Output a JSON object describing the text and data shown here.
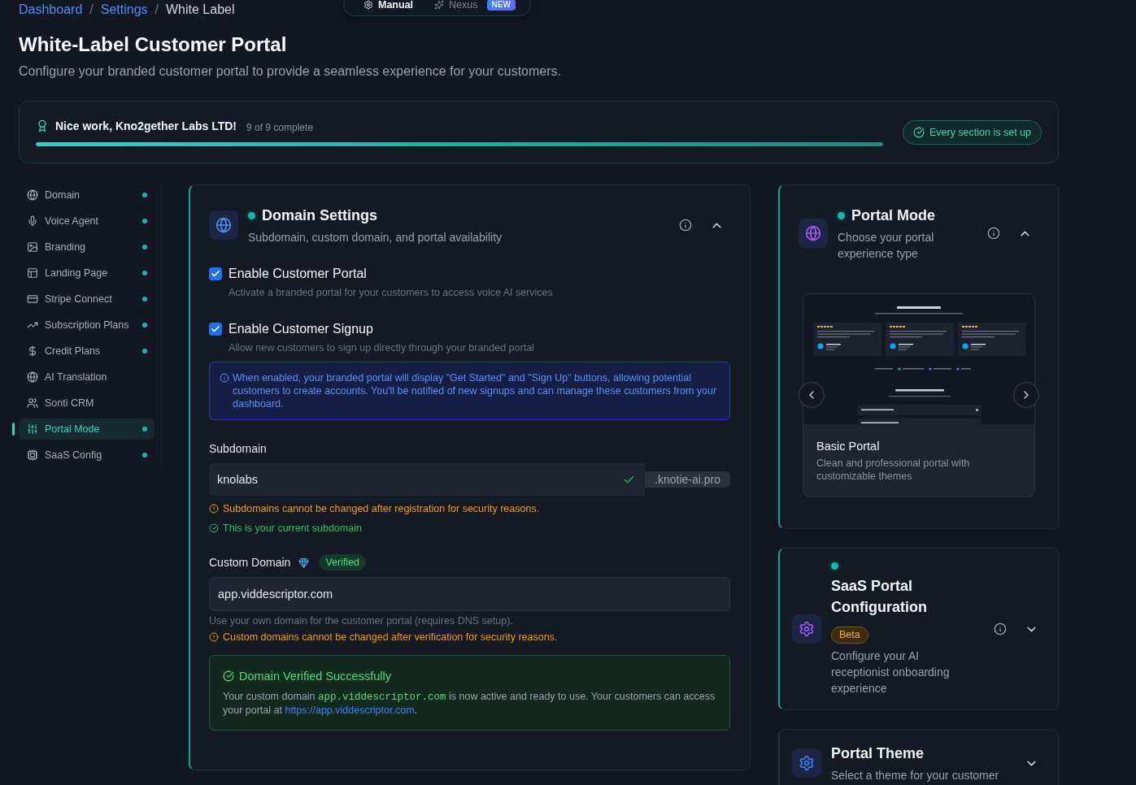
{
  "breadcrumb": {
    "items": [
      {
        "label": "Dashboard",
        "current": false
      },
      {
        "label": "Settings",
        "current": false
      },
      {
        "label": "White Label",
        "current": true
      }
    ],
    "separators": [
      "/",
      "/"
    ]
  },
  "mode_switch": {
    "options": [
      {
        "label": "Manual",
        "selected": true
      },
      {
        "label": "Nexus",
        "selected": false,
        "badge": "NEW"
      }
    ]
  },
  "header": {
    "title": "White-Label Customer Portal",
    "subtitle": "Configure your branded customer portal to provide a seamless experience for your customers."
  },
  "progress": {
    "message": "Nice work, Kno2gether Labs LTD!",
    "count": "9 of 9 complete",
    "level": 1,
    "status": "Every section is set up"
  },
  "sidebar": {
    "items": [
      {
        "label": "Domain",
        "complete": true,
        "selected": false
      },
      {
        "label": "Voice Agent",
        "complete": true,
        "selected": false
      },
      {
        "label": "Branding",
        "complete": true,
        "selected": false
      },
      {
        "label": "Landing Page",
        "complete": true,
        "selected": false
      },
      {
        "label": "Stripe Connect",
        "complete": true,
        "selected": false
      },
      {
        "label": "Subscription Plans",
        "complete": true,
        "selected": false
      },
      {
        "label": "Credit Plans",
        "complete": true,
        "selected": false
      },
      {
        "label": "AI Translation",
        "complete": false,
        "selected": false
      },
      {
        "label": "Sonti CRM",
        "complete": false,
        "selected": false
      },
      {
        "label": "Portal Mode",
        "complete": true,
        "selected": true
      },
      {
        "label": "SaaS Config",
        "complete": true,
        "selected": false
      }
    ]
  },
  "domain_settings": {
    "title": "Domain Settings",
    "subtitle": "Subdomain, custom domain, and portal availability",
    "complete": true,
    "expanded": true,
    "info_button": true,
    "toggles": [
      {
        "label": "Enable Customer Portal",
        "description": "Activate a branded portal for your customers to access voice AI services",
        "checked": true
      },
      {
        "label": "Enable Customer Signup",
        "description": "Allow new customers to sign up directly through your branded portal",
        "checked": true
      }
    ],
    "notice": "When enabled, your branded portal will display \"Get Started\" and \"Sign Up\" buttons, allowing potential customers to create accounts. You'll be notified of new signups and can manage these customers from your dashboard.",
    "subdomain": {
      "label": "Subdomain",
      "value": "knolabs",
      "valid": true,
      "suffix": ".knotie-ai.pro",
      "warning": "Subdomains cannot be changed after registration for security reasons.",
      "confirmation": "This is your current subdomain"
    },
    "custom_domain": {
      "label": "Custom Domain",
      "badge": "Verified",
      "value": "app.viddescriptor.com",
      "help": "Use your own domain for the customer portal (requires DNS setup).",
      "warning": "Custom domains cannot be changed after verification for security reasons.",
      "success": {
        "title": "Domain Verified Successfully",
        "text_before": "Your custom domain ",
        "code": "app.viddescriptor.com",
        "text_middle": " is now active and ready to use. Your customers can access your portal at ",
        "link": "https://app.viddescriptor.com",
        "text_after": "."
      }
    }
  },
  "side_sections": [
    {
      "title": "Portal Mode",
      "subtitle": "Choose your portal experience type",
      "complete": true,
      "expanded": true,
      "info_button": true,
      "preview": {
        "title": "Basic Portal",
        "description": "Clean and professional portal with customizable themes"
      }
    },
    {
      "title": "SaaS Portal Configuration",
      "badge": "Beta",
      "subtitle": "Configure your AI receptionist onboarding experience",
      "complete": true,
      "expanded": false,
      "info_button": true
    },
    {
      "title": "Portal Theme",
      "subtitle": "Select a theme for your customer",
      "complete": false,
      "expanded": false,
      "info_button": false
    }
  ]
}
